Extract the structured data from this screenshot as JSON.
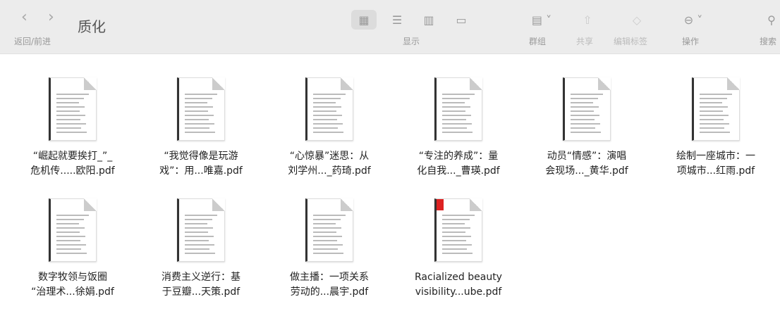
{
  "toolbar": {
    "back": "‹",
    "forward": "›",
    "title": "质化",
    "back_forward_label": "返回/前进",
    "view_label": "显示",
    "group_label": "群组",
    "share_label": "共享",
    "tags_label": "编辑标签",
    "action_label": "操作",
    "search_label": "搜索"
  },
  "files": [
    {
      "line1": "“崛起就要挨打_”_",
      "line2": "危机传.....欧阳.pdf"
    },
    {
      "line1": "“我觉得像是玩游",
      "line2": "戏”：用...唯嘉.pdf"
    },
    {
      "line1": "“心惊暴”迷思：从",
      "line2": "刘学州..._药琦.pdf"
    },
    {
      "line1": "“专注的养成”：量",
      "line2": "化自我..._曹瑛.pdf"
    },
    {
      "line1": "动员“情感”：演唱",
      "line2": "会现场..._黄华.pdf"
    },
    {
      "line1": "绘制一座城市：一",
      "line2": "项城市...红雨.pdf"
    },
    {
      "line1": "数字牧领与饭圈",
      "line2": "“治理术...徐娟.pdf"
    },
    {
      "line1": "消费主义逆行：基",
      "line2": "于豆瓣...天策.pdf"
    },
    {
      "line1": "做主播：一项关系",
      "line2": "劳动的...晨宇.pdf"
    },
    {
      "line1": "Racialized beauty",
      "line2": "visibility...ube.pdf"
    }
  ]
}
